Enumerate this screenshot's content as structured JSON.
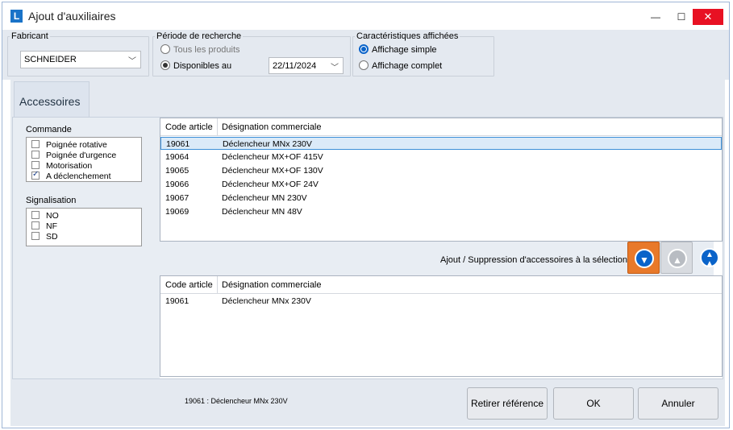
{
  "window": {
    "title": "Ajout d'auxiliaires",
    "min": "—",
    "max": "☐",
    "close": "✕",
    "app_icon": "L"
  },
  "fabricant": {
    "label": "Fabricant",
    "value": "SCHNEIDER"
  },
  "periode": {
    "label": "Période de recherche",
    "opt1": "Tous les produits",
    "opt2": "Disponibles au",
    "date": "22/11/2024",
    "selected": "Disponibles au"
  },
  "caract": {
    "label": "Caractéristiques affichées",
    "opt1": "Affichage simple",
    "opt2": "Affichage complet",
    "selected": "Affichage simple"
  },
  "tab": {
    "label": "Accessoires"
  },
  "commande": {
    "label": "Commande",
    "items": [
      {
        "label": "Poignée rotative",
        "checked": false
      },
      {
        "label": "Poignée d'urgence",
        "checked": false
      },
      {
        "label": "Motorisation",
        "checked": false
      },
      {
        "label": "A déclenchement",
        "checked": true
      }
    ]
  },
  "signalisation": {
    "label": "Signalisation",
    "items": [
      {
        "label": "NO",
        "checked": false
      },
      {
        "label": "NF",
        "checked": false
      },
      {
        "label": "SD",
        "checked": false
      }
    ]
  },
  "grid1": {
    "col1": "Code article",
    "col2": "Désignation commerciale",
    "rows": [
      {
        "code": "19061",
        "des": "Déclencheur MNx 230V"
      },
      {
        "code": "19064",
        "des": "Déclencheur MX+OF 415V"
      },
      {
        "code": "19065",
        "des": "Déclencheur MX+OF 130V"
      },
      {
        "code": "19066",
        "des": "Déclencheur MX+OF 24V"
      },
      {
        "code": "19067",
        "des": "Déclencheur MN 230V"
      },
      {
        "code": "19069",
        "des": "Déclencheur MN 48V"
      }
    ],
    "selected_row": "19061"
  },
  "midbar": {
    "label": "Ajout / Suppression d'accessoires à la sélection :"
  },
  "grid2": {
    "col1": "Code article",
    "col2": "Désignation commerciale",
    "rows": [
      {
        "code": "19061",
        "des": "Déclencheur MNx 230V"
      }
    ]
  },
  "status": {
    "text": "19061 : Déclencheur MNx 230V"
  },
  "buttons": {
    "retirer": "Retirer référence",
    "ok": "OK",
    "annuler": "Annuler"
  },
  "colors": {
    "accent": "#0a63c9",
    "orange": "#e8792a",
    "close": "#e81123"
  }
}
